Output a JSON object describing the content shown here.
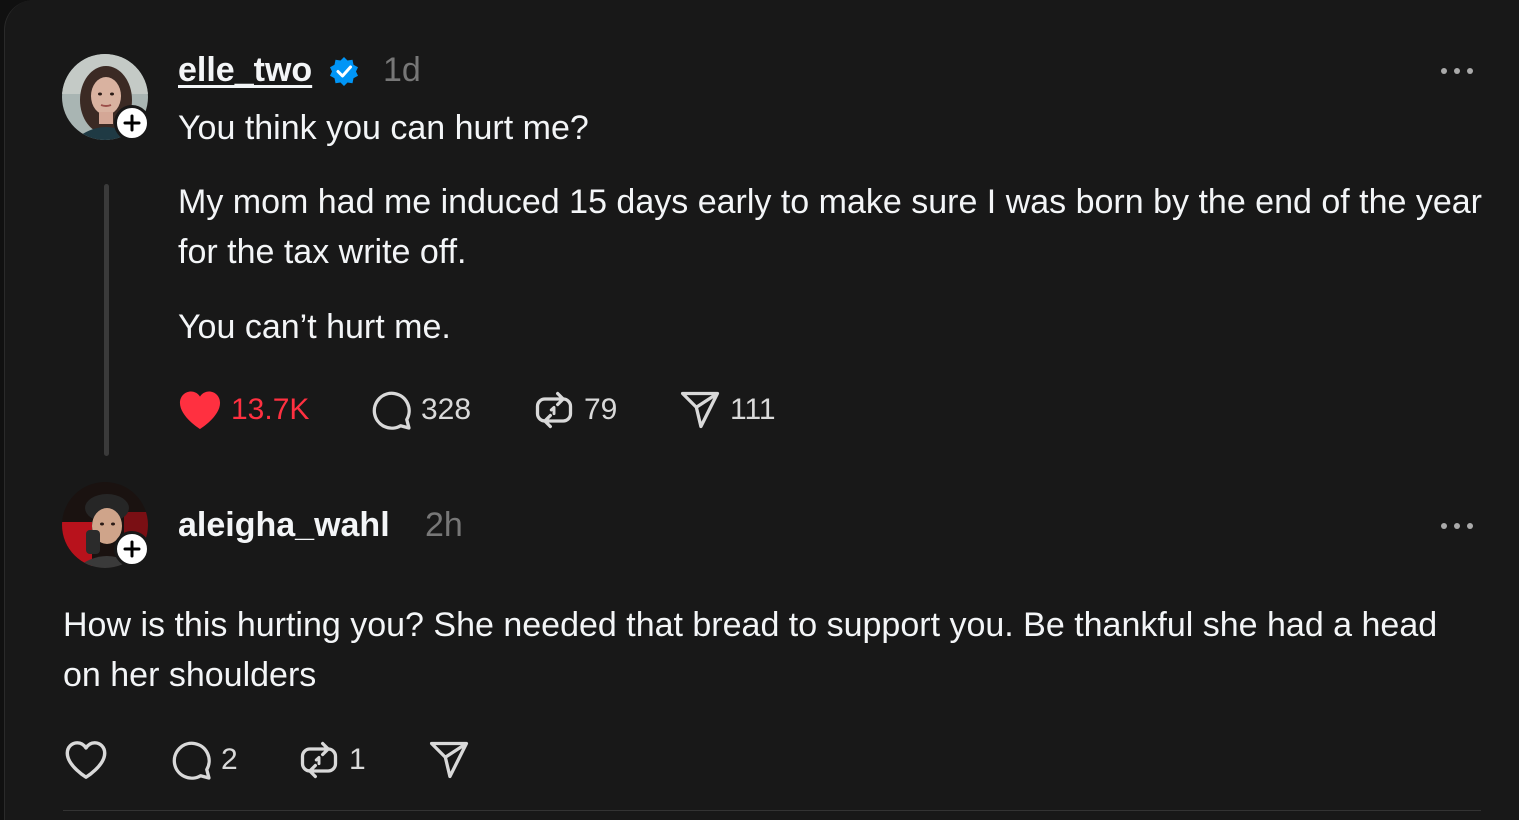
{
  "post": {
    "username": "elle_two",
    "verified": true,
    "timestamp": "1d",
    "headline": "You think you can hurt me?",
    "paragraph_1": "My mom had me induced 15 days early to make sure I was born by the end of the year for the tax write off.",
    "paragraph_2": "You can’t hurt me.",
    "actions": {
      "like_count": "13.7K",
      "liked": true,
      "reply_count": "328",
      "repost_count": "79",
      "share_count": "111"
    }
  },
  "reply": {
    "username": "aleigha_wahl",
    "timestamp": "2h",
    "text": "How is this hurting you? She needed that bread to support you. Be thankful she had a head on her shoulders",
    "actions": {
      "like_count": "",
      "reply_count": "2",
      "repost_count": "1",
      "share_count": ""
    }
  },
  "icons": {
    "more": "more-options-icon",
    "verified": "verified-badge-icon",
    "follow": "plus-icon",
    "like": "heart-icon",
    "reply": "comment-icon",
    "repost": "repost-icon",
    "share": "send-icon"
  },
  "colors": {
    "background": "#181818",
    "text": "#f3f5f7",
    "muted": "#777777",
    "like_active": "#ff3040",
    "verified": "#0095f6"
  }
}
